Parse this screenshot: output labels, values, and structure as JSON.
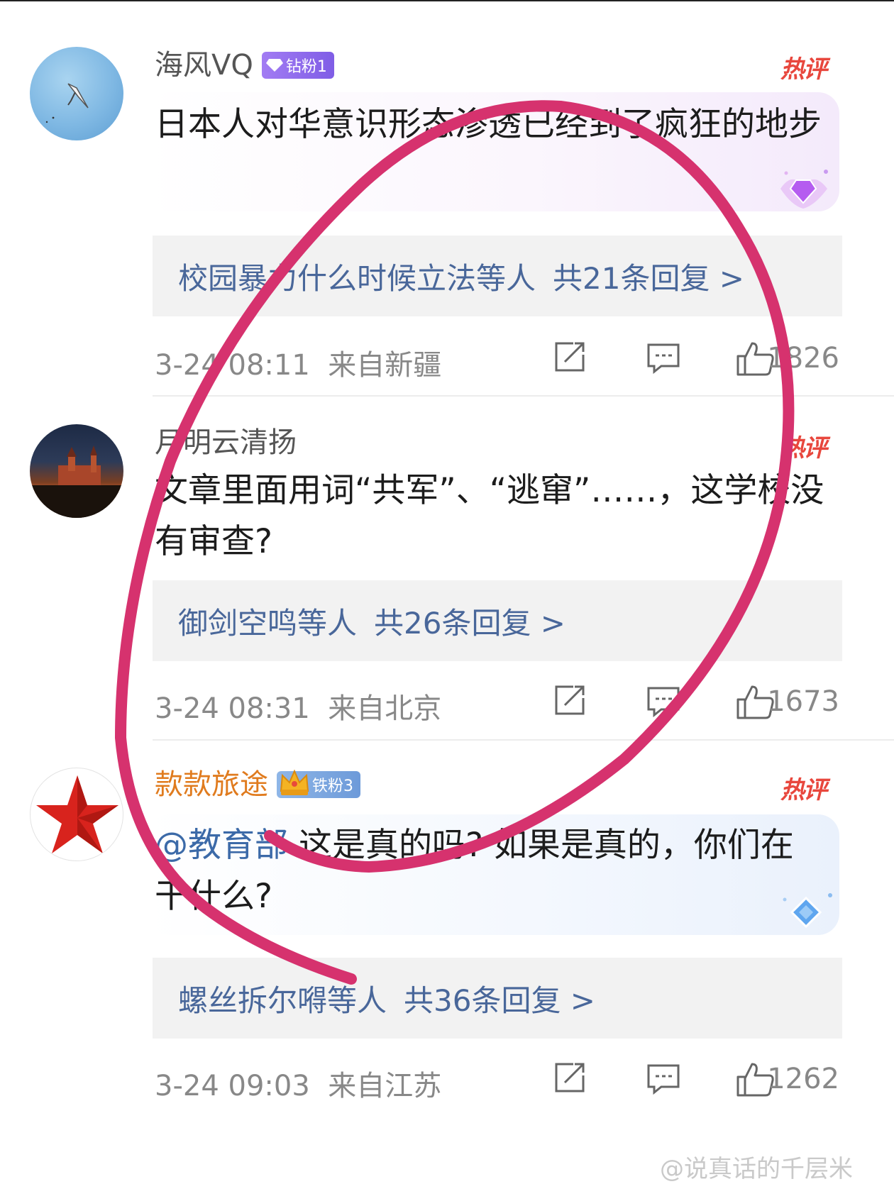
{
  "comments": [
    {
      "username": "海风VQ",
      "badge": "钻粉1",
      "hot": "热评",
      "text": "日本人对华意识形态渗透已经到了疯狂的地步",
      "reply_names": "校园暴力什么时候立法等人",
      "reply_count": "共21条回复 >",
      "time": "3-24 08:11",
      "location": "来自新疆",
      "likes": "1826"
    },
    {
      "username": "月明云清扬",
      "hot": "热评",
      "text": "文章里面用词“共军”、“逃窜”……，这学校没有审查?",
      "reply_names": "御剑空鸣等人",
      "reply_count": "共26条回复 >",
      "time": "3-24 08:31",
      "location": "来自北京",
      "likes": "1673"
    },
    {
      "username": "款款旅途",
      "badge": "铁粉3",
      "hot": "热评",
      "mention": "@教育部",
      "text": " 这是真的吗? 如果是真的，你们在干什么?",
      "reply_names": "螺丝拆尔嘚等人",
      "reply_count": "共36条回复 >",
      "time": "3-24 09:03",
      "location": "来自江苏",
      "likes": "1262"
    }
  ],
  "watermark": "@说真话的千层米",
  "icons": {
    "share": "share-icon",
    "comment": "comment-icon",
    "like": "thumbs-up-icon",
    "badge_diamond": "diamond-icon",
    "badge_crown": "crown-icon"
  },
  "colors": {
    "hot": "#e8473d",
    "reply_link": "#49679a",
    "mention": "#3c6aa8",
    "badge_diamond": "#8f6af0",
    "badge_iron": "#7aa4de",
    "username_orange": "#e07b1e",
    "annotation_stroke": "#d6326e"
  }
}
